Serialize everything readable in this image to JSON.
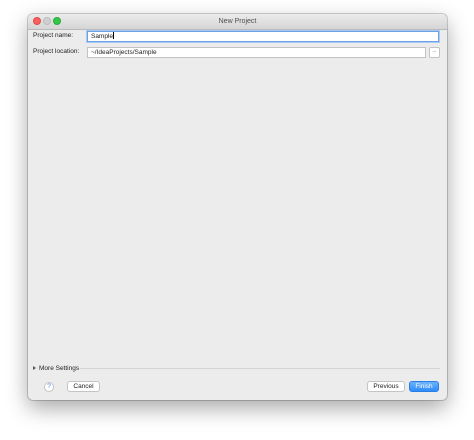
{
  "window": {
    "title": "New Project"
  },
  "form": {
    "project_name": {
      "label": "Project name:",
      "value": "Sample"
    },
    "project_location": {
      "label": "Project location:",
      "value": "~/IdeaProjects/Sample",
      "browse_label": "..."
    }
  },
  "more_settings": {
    "label": "More Settings"
  },
  "footer": {
    "help_label": "?",
    "cancel_label": "Cancel",
    "previous_label": "Previous",
    "finish_label": "Finish"
  },
  "colors": {
    "accent": "#2d8bf7",
    "close": "#fc605c",
    "maximize": "#34c84a",
    "background": "#ececec"
  },
  "icons": {
    "help": "help-icon",
    "expand": "disclosure-triangle-icon",
    "browse": "folder-browse-icon"
  }
}
